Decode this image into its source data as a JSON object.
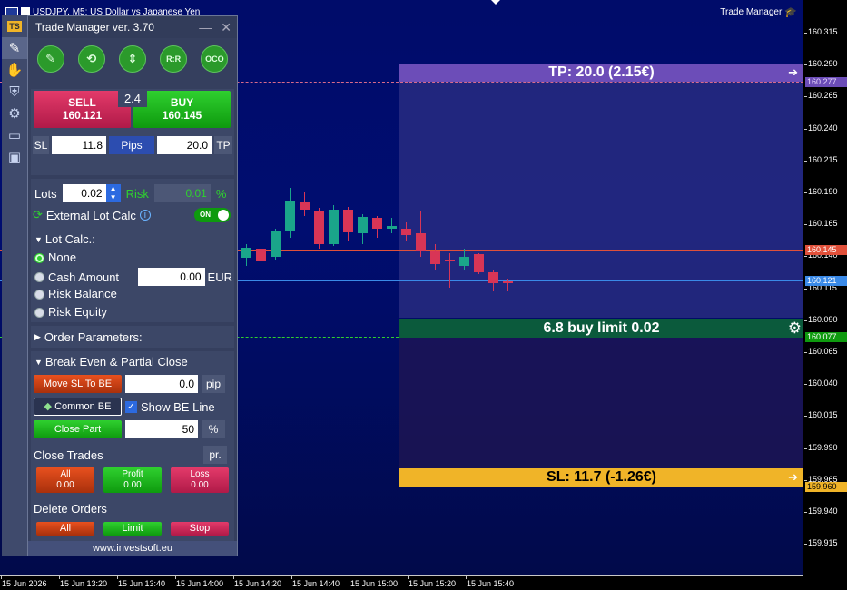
{
  "chart": {
    "symbol_title": "USDJPY, M5:  US Dollar vs Japanese Yen",
    "indicator_label": "Trade Manager",
    "colors": {
      "background": "#000c6a",
      "bull": "#1aa58a",
      "bear": "#d83556",
      "tp": "#6b4fb8",
      "pending": "#0a5a3a",
      "sl": "#f0b428"
    },
    "price_ticks": [
      "160.315",
      "160.290",
      "160.265",
      "160.240",
      "160.215",
      "160.190",
      "160.165",
      "160.140",
      "160.115",
      "160.090",
      "160.065",
      "160.040",
      "160.015",
      "159.990",
      "159.965",
      "159.940",
      "159.915"
    ],
    "time_ticks": [
      "15 Jun 2026",
      "15 Jun 13:20",
      "15 Jun 13:40",
      "15 Jun 14:00",
      "15 Jun 14:20",
      "15 Jun 14:40",
      "15 Jun 15:00",
      "15 Jun 15:20",
      "15 Jun 15:40"
    ],
    "price_labels": {
      "tp": "160.277",
      "ask": "160.145",
      "bid": "160.121",
      "entry": "160.077",
      "sl": "159.960"
    },
    "tp_bar": "TP: 20.0 (2.15€)",
    "pending_bar": "6.8 buy limit 0.02",
    "sl_bar": "SL: 11.7 (-1.26€)",
    "candles": [
      {
        "o": 160.139,
        "h": 160.15,
        "l": 160.133,
        "c": 160.147
      },
      {
        "o": 160.146,
        "h": 160.148,
        "l": 160.131,
        "c": 160.137
      },
      {
        "o": 160.14,
        "h": 160.162,
        "l": 160.138,
        "c": 160.16
      },
      {
        "o": 160.16,
        "h": 160.194,
        "l": 160.155,
        "c": 160.184
      },
      {
        "o": 160.183,
        "h": 160.19,
        "l": 160.172,
        "c": 160.177
      },
      {
        "o": 160.176,
        "h": 160.178,
        "l": 160.146,
        "c": 160.15
      },
      {
        "o": 160.15,
        "h": 160.18,
        "l": 160.148,
        "c": 160.177
      },
      {
        "o": 160.177,
        "h": 160.179,
        "l": 160.152,
        "c": 160.159
      },
      {
        "o": 160.158,
        "h": 160.173,
        "l": 160.15,
        "c": 160.171
      },
      {
        "o": 160.17,
        "h": 160.172,
        "l": 160.155,
        "c": 160.162
      },
      {
        "o": 160.162,
        "h": 160.17,
        "l": 160.158,
        "c": 160.164
      },
      {
        "o": 160.162,
        "h": 160.167,
        "l": 160.152,
        "c": 160.157
      },
      {
        "o": 160.158,
        "h": 160.176,
        "l": 160.14,
        "c": 160.144
      },
      {
        "o": 160.144,
        "h": 160.15,
        "l": 160.13,
        "c": 160.134
      },
      {
        "o": 160.138,
        "h": 160.143,
        "l": 160.116,
        "c": 160.136
      },
      {
        "o": 160.133,
        "h": 160.146,
        "l": 160.13,
        "c": 160.14
      },
      {
        "o": 160.142,
        "h": 160.143,
        "l": 160.126,
        "c": 160.128
      },
      {
        "o": 160.128,
        "h": 160.129,
        "l": 160.113,
        "c": 160.119
      },
      {
        "o": 160.121,
        "h": 160.123,
        "l": 160.113,
        "c": 160.119
      }
    ]
  },
  "panel": {
    "title": "Trade Manager ver. 3.70",
    "tools": [
      "✎",
      "⟲",
      "⇕",
      "R:R",
      "OCO"
    ],
    "sell_label": "SELL",
    "sell_price": "160.121",
    "buy_label": "BUY",
    "buy_price": "160.145",
    "spread": "2.4",
    "sl_label": "SL",
    "sl_value": "11.8",
    "pips_label": "Pips",
    "tp_value": "20.0",
    "tp_label": "TP",
    "lots_label": "Lots",
    "lots_value": "0.02",
    "risk_label": "Risk",
    "risk_value": "0.01",
    "risk_unit": "%",
    "ext_lot_label": "External Lot Calc",
    "toggle_label": "ON",
    "lot_calc_label": "Lot Calc.:",
    "opt_none": "None",
    "opt_cash": "Cash Amount",
    "cash_value": "0.00",
    "cash_unit": "EUR",
    "opt_balance": "Risk Balance",
    "opt_equity": "Risk Equity",
    "order_params_label": "Order Parameters:",
    "be_label": "Break Even & Partial Close",
    "move_sl_label": "Move SL To BE",
    "move_sl_value": "0.0",
    "move_sl_unit": "pip",
    "common_be_label": "Common BE",
    "show_be_label": "Show BE Line",
    "close_part_label": "Close Part",
    "close_part_value": "50",
    "close_part_unit": "%",
    "close_trades_label": "Close Trades",
    "pr_label": "pr.",
    "close_all_label": "All",
    "close_all_value": "0.00",
    "close_profit_label": "Profit",
    "close_profit_value": "0.00",
    "close_loss_label": "Loss",
    "close_loss_value": "0.00",
    "delete_orders_label": "Delete Orders",
    "del_all_label": "All",
    "del_limit_label": "Limit",
    "del_stop_label": "Stop",
    "footer": "www.investsoft.eu"
  }
}
